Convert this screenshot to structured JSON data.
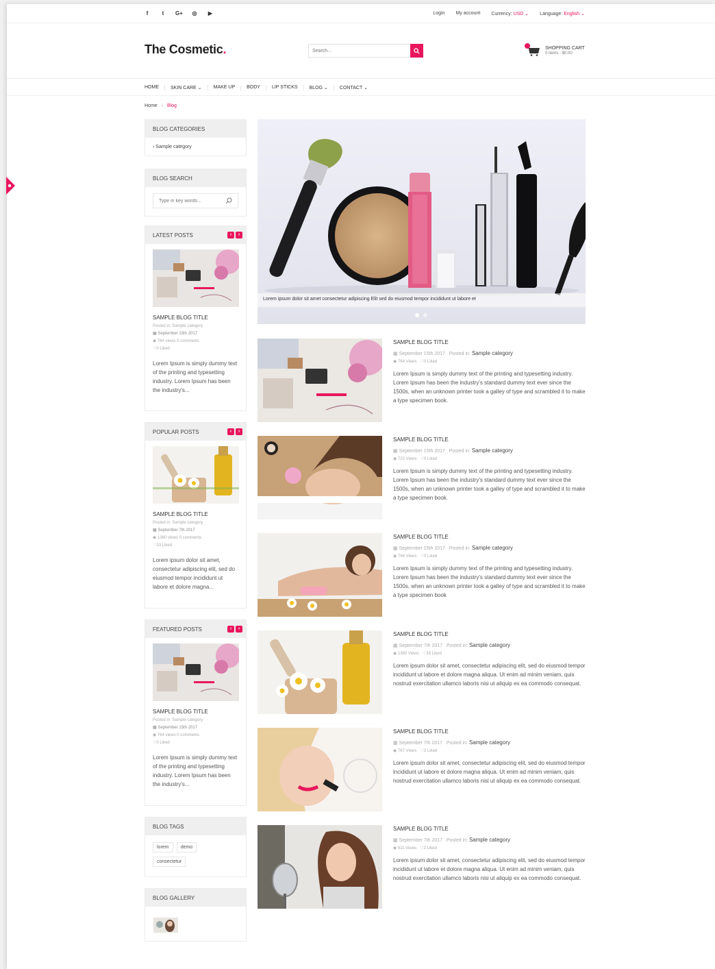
{
  "topbar": {
    "social_icons": [
      "facebook-icon",
      "twitter-icon",
      "google-plus-icon",
      "instagram-icon",
      "youtube-icon"
    ],
    "social_glyphs": [
      "f",
      "t",
      "G+",
      "◎",
      "▶"
    ],
    "login": "Login",
    "my_account": "My account",
    "currency_label": "Currency:",
    "currency_value": "USD",
    "language_label": "Language:",
    "language_value": "English"
  },
  "header": {
    "logo_text": "The Cosmetic",
    "logo_dot": ".",
    "search_placeholder": "Search...",
    "cart_title": "SHOPPING CART",
    "cart_summary": "0 items - $0.00"
  },
  "nav": {
    "items": [
      "HOME",
      "SKIN CARE",
      "MAKE UP",
      "BODY",
      "LIP STICKS",
      "BLOG",
      "CONTACT"
    ],
    "dropdowns": [
      false,
      true,
      false,
      false,
      false,
      true,
      true
    ]
  },
  "breadcrumb": {
    "home": "Home",
    "separator": "›",
    "current": "Blog"
  },
  "sidebar": {
    "categories": {
      "title": "BLOG CATEGORIES",
      "items": [
        "Sample category"
      ]
    },
    "search": {
      "title": "BLOG SEARCH",
      "placeholder": "Type in key words..."
    },
    "latest": {
      "title": "LATEST POSTS",
      "post_title": "SAMPLE BLOG TITLE",
      "posted_in": "Posted in: Sample category",
      "date": "September 15th 2017",
      "stats": "764 views   0 comments",
      "liked": "0 Liked",
      "excerpt": "Lorem Ipsum is simply dummy text of the printing and typesetting industry. Lorem Ipsum has been the industry's..."
    },
    "popular": {
      "title": "POPULAR POSTS",
      "post_title": "SAMPLE BLOG TITLE",
      "posted_in": "Posted in: Sample category",
      "date": "September 7th 2017",
      "stats": "1360 views   0 comments",
      "liked": "33 Liked",
      "excerpt": "Lorem ipsum dolor sit amet, consectetur adipiscing elit, sed do eiusmod tempor incididunt ut labore et dolore magna..."
    },
    "featured": {
      "title": "FEATURED POSTS",
      "post_title": "SAMPLE BLOG TITLE",
      "posted_in": "Posted in: Sample category",
      "date": "September 15th 2017",
      "stats": "764 views   0 comments",
      "liked": "0 Liked",
      "excerpt": "Lorem Ipsum is simply dummy text of the printing and typesetting industry. Lorem Ipsum has been the industry's..."
    },
    "tags": {
      "title": "BLOG TAGS",
      "items": [
        "lorem",
        "demo",
        "consectetur"
      ]
    },
    "gallery": {
      "title": "BLOG GALLERY"
    }
  },
  "slider": {
    "caption": "Lorem ipsum dolor sit amet consectetur adipiscing Elit sed do eiusmod tempor incididunt ut labore et"
  },
  "posts": [
    {
      "title": "SAMPLE BLOG TITLE",
      "date": "September 15th 2017",
      "posted_in_label": "Posted in:",
      "category": "Sample category",
      "views": "764 Views",
      "liked": "0 Liked",
      "excerpt": "Lorem Ipsum is simply dummy text of the printing and typesetting industry. Lorem Ipsum has been the industry's standard dummy text ever since the 1500s, when an unknown printer took a galley of type and scrambled it to make a type specimen book."
    },
    {
      "title": "SAMPLE BLOG TITLE",
      "date": "September 15th 2017",
      "posted_in_label": "Posted in:",
      "category": "Sample category",
      "views": "720 Views",
      "liked": "0 Liked",
      "excerpt": "Lorem Ipsum is simply dummy text of the printing and typesetting industry. Lorem Ipsum has been the industry's standard dummy text ever since the 1500s, when an unknown printer took a galley of type and scrambled it to make a type specimen book."
    },
    {
      "title": "SAMPLE BLOG TITLE",
      "date": "September 15th 2017",
      "posted_in_label": "Posted in:",
      "category": "Sample category",
      "views": "746 Views",
      "liked": "0 Liked",
      "excerpt": "Lorem Ipsum is simply dummy text of the printing and typesetting industry. Lorem Ipsum has been the industry's standard dummy text ever since the 1500s, when an unknown printer took a galley of type and scrambled it to make a type specimen book"
    },
    {
      "title": "SAMPLE BLOG TITLE",
      "date": "September 7th 2017",
      "posted_in_label": "Posted in:",
      "category": "Sample category",
      "views": "1360 Views",
      "liked": "33 Liked",
      "excerpt": "Lorem ipsum dolor sit amet, consectetur adipiscing elit, sed do eiusmod tempor incididunt ut labore et dolore magna aliqua. Ut enim ad minim veniam, quis nostrud exercitation ullamco laboris nisi ut aliquip ex ea commodo consequat."
    },
    {
      "title": "SAMPLE BLOG TITLE",
      "date": "September 7th 2017",
      "posted_in_label": "Posted in:",
      "category": "Sample category",
      "views": "767 Views",
      "liked": "3 Liked",
      "excerpt": "Lorem ipsum dolor sit amet, consectetur adipiscing elit, sed do eiusmod tempor incididunt ut labore et dolore magna aliqua. Ut enim ad minim veniam, quis nostrud exercitation ullamco laboris nisi ut aliquip ex ea commodo consequat."
    },
    {
      "title": "SAMPLE BLOG TITLE",
      "date": "September 7th 2017",
      "posted_in_label": "Posted in:",
      "category": "Sample category",
      "views": "611 Views",
      "liked": "2 Liked",
      "excerpt": "Lorem ipsum dolor sit amet, consectetur adipiscing elit, sed do eiusmod tempor incididunt ut labore et dolore magna aliqua. Ut enim ad minim veniam, quis nostrud exercitation ullamco laboris nisi ut aliquip ex ea commodo consequat."
    }
  ],
  "colors": {
    "accent": "#e8175d",
    "panel_header": "#efefef",
    "text": "#555555"
  }
}
